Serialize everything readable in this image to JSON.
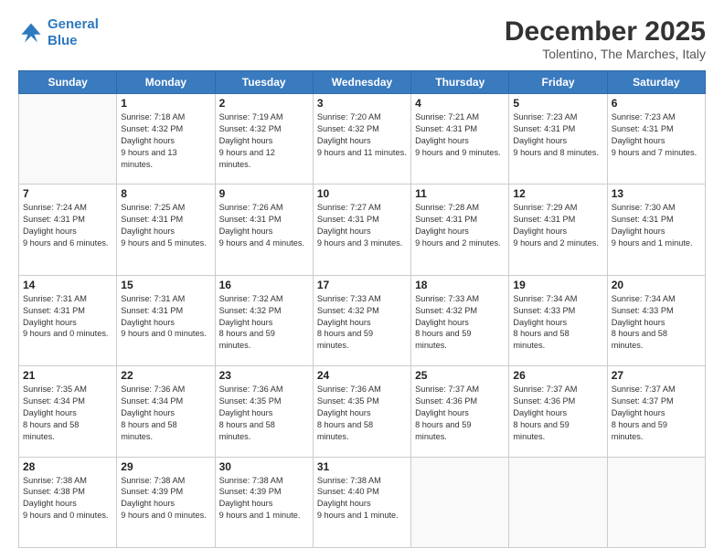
{
  "logo": {
    "line1": "General",
    "line2": "Blue"
  },
  "title": "December 2025",
  "location": "Tolentino, The Marches, Italy",
  "weekdays": [
    "Sunday",
    "Monday",
    "Tuesday",
    "Wednesday",
    "Thursday",
    "Friday",
    "Saturday"
  ],
  "weeks": [
    [
      {
        "day": "",
        "sunrise": "",
        "sunset": "",
        "daylight": ""
      },
      {
        "day": "1",
        "sunrise": "7:18 AM",
        "sunset": "4:32 PM",
        "daylight": "9 hours and 13 minutes."
      },
      {
        "day": "2",
        "sunrise": "7:19 AM",
        "sunset": "4:32 PM",
        "daylight": "9 hours and 12 minutes."
      },
      {
        "day": "3",
        "sunrise": "7:20 AM",
        "sunset": "4:32 PM",
        "daylight": "9 hours and 11 minutes."
      },
      {
        "day": "4",
        "sunrise": "7:21 AM",
        "sunset": "4:31 PM",
        "daylight": "9 hours and 9 minutes."
      },
      {
        "day": "5",
        "sunrise": "7:23 AM",
        "sunset": "4:31 PM",
        "daylight": "9 hours and 8 minutes."
      },
      {
        "day": "6",
        "sunrise": "7:23 AM",
        "sunset": "4:31 PM",
        "daylight": "9 hours and 7 minutes."
      }
    ],
    [
      {
        "day": "7",
        "sunrise": "7:24 AM",
        "sunset": "4:31 PM",
        "daylight": "9 hours and 6 minutes."
      },
      {
        "day": "8",
        "sunrise": "7:25 AM",
        "sunset": "4:31 PM",
        "daylight": "9 hours and 5 minutes."
      },
      {
        "day": "9",
        "sunrise": "7:26 AM",
        "sunset": "4:31 PM",
        "daylight": "9 hours and 4 minutes."
      },
      {
        "day": "10",
        "sunrise": "7:27 AM",
        "sunset": "4:31 PM",
        "daylight": "9 hours and 3 minutes."
      },
      {
        "day": "11",
        "sunrise": "7:28 AM",
        "sunset": "4:31 PM",
        "daylight": "9 hours and 2 minutes."
      },
      {
        "day": "12",
        "sunrise": "7:29 AM",
        "sunset": "4:31 PM",
        "daylight": "9 hours and 2 minutes."
      },
      {
        "day": "13",
        "sunrise": "7:30 AM",
        "sunset": "4:31 PM",
        "daylight": "9 hours and 1 minute."
      }
    ],
    [
      {
        "day": "14",
        "sunrise": "7:31 AM",
        "sunset": "4:31 PM",
        "daylight": "9 hours and 0 minutes."
      },
      {
        "day": "15",
        "sunrise": "7:31 AM",
        "sunset": "4:31 PM",
        "daylight": "9 hours and 0 minutes."
      },
      {
        "day": "16",
        "sunrise": "7:32 AM",
        "sunset": "4:32 PM",
        "daylight": "8 hours and 59 minutes."
      },
      {
        "day": "17",
        "sunrise": "7:33 AM",
        "sunset": "4:32 PM",
        "daylight": "8 hours and 59 minutes."
      },
      {
        "day": "18",
        "sunrise": "7:33 AM",
        "sunset": "4:32 PM",
        "daylight": "8 hours and 59 minutes."
      },
      {
        "day": "19",
        "sunrise": "7:34 AM",
        "sunset": "4:33 PM",
        "daylight": "8 hours and 58 minutes."
      },
      {
        "day": "20",
        "sunrise": "7:34 AM",
        "sunset": "4:33 PM",
        "daylight": "8 hours and 58 minutes."
      }
    ],
    [
      {
        "day": "21",
        "sunrise": "7:35 AM",
        "sunset": "4:34 PM",
        "daylight": "8 hours and 58 minutes."
      },
      {
        "day": "22",
        "sunrise": "7:36 AM",
        "sunset": "4:34 PM",
        "daylight": "8 hours and 58 minutes."
      },
      {
        "day": "23",
        "sunrise": "7:36 AM",
        "sunset": "4:35 PM",
        "daylight": "8 hours and 58 minutes."
      },
      {
        "day": "24",
        "sunrise": "7:36 AM",
        "sunset": "4:35 PM",
        "daylight": "8 hours and 58 minutes."
      },
      {
        "day": "25",
        "sunrise": "7:37 AM",
        "sunset": "4:36 PM",
        "daylight": "8 hours and 59 minutes."
      },
      {
        "day": "26",
        "sunrise": "7:37 AM",
        "sunset": "4:36 PM",
        "daylight": "8 hours and 59 minutes."
      },
      {
        "day": "27",
        "sunrise": "7:37 AM",
        "sunset": "4:37 PM",
        "daylight": "8 hours and 59 minutes."
      }
    ],
    [
      {
        "day": "28",
        "sunrise": "7:38 AM",
        "sunset": "4:38 PM",
        "daylight": "9 hours and 0 minutes."
      },
      {
        "day": "29",
        "sunrise": "7:38 AM",
        "sunset": "4:39 PM",
        "daylight": "9 hours and 0 minutes."
      },
      {
        "day": "30",
        "sunrise": "7:38 AM",
        "sunset": "4:39 PM",
        "daylight": "9 hours and 1 minute."
      },
      {
        "day": "31",
        "sunrise": "7:38 AM",
        "sunset": "4:40 PM",
        "daylight": "9 hours and 1 minute."
      },
      {
        "day": "",
        "sunrise": "",
        "sunset": "",
        "daylight": ""
      },
      {
        "day": "",
        "sunrise": "",
        "sunset": "",
        "daylight": ""
      },
      {
        "day": "",
        "sunrise": "",
        "sunset": "",
        "daylight": ""
      }
    ]
  ]
}
